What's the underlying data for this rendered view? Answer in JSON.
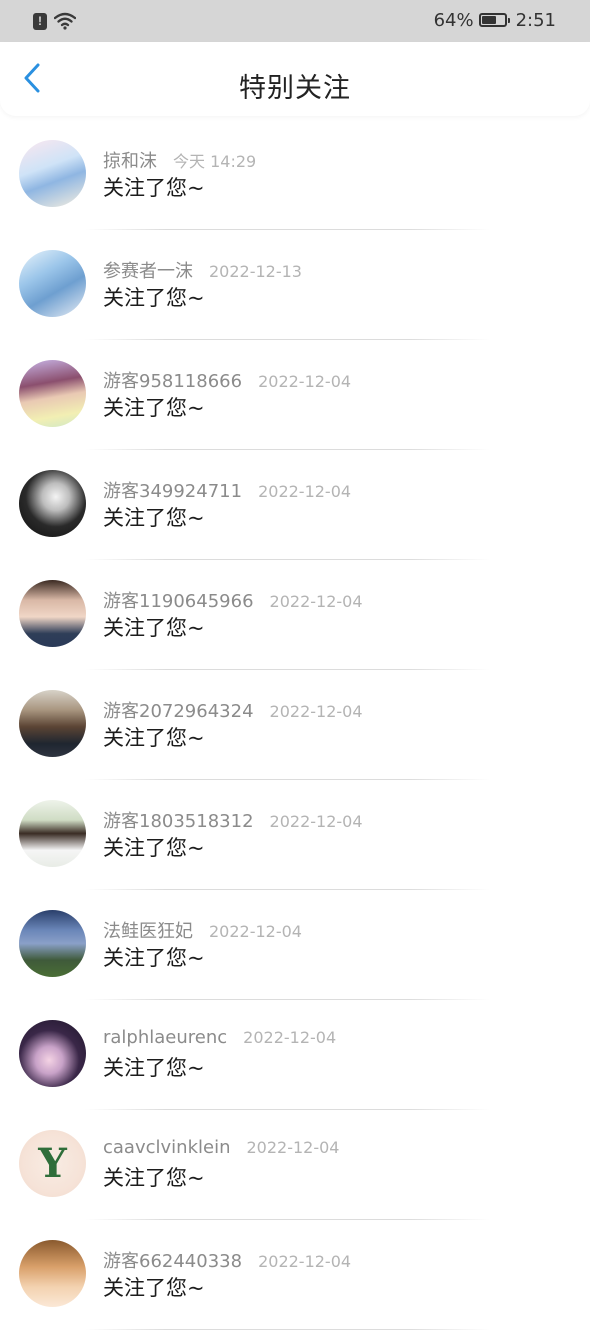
{
  "status_bar": {
    "battery_percent": "64%",
    "battery_level": 0.64,
    "time": "2:51",
    "icons": [
      "alert-icon",
      "wifi-icon",
      "battery-icon"
    ]
  },
  "header": {
    "title": "特别关注",
    "back_icon": "chevron-left-icon",
    "accent_color": "#2a90e0"
  },
  "list": {
    "items": [
      {
        "name": "掠和沫",
        "date": "今天 14:29",
        "action": "关注了您~",
        "avatar": {
          "bg": "linear-gradient(160deg,#fbe7ef 0%,#cfe3f7 40%,#8fb6e2 60%,#f6efe0 100%)",
          "glyph": ""
        }
      },
      {
        "name": "参赛者一沫",
        "date": "2022-12-13",
        "action": "关注了您~",
        "avatar": {
          "bg": "linear-gradient(150deg,#eaf4fb 0%,#9cc6ea 35%,#6e9fd0 60%,#e9eef5 100%)",
          "glyph": ""
        }
      },
      {
        "name": "游客958118666",
        "date": "2022-12-04",
        "action": "关注了您~",
        "avatar": {
          "bg": "linear-gradient(170deg,#c9b6e8 0%,#8b4f6e 35%,#e9c9b3 55%,#f2efb3 80%,#cfe8c6 100%)",
          "glyph": ""
        }
      },
      {
        "name": "游客349924711",
        "date": "2022-12-04",
        "action": "关注了您~",
        "avatar": {
          "bg": "radial-gradient(circle at 55% 40%,#f4f4f4 0%,#bdbdbd 25%,#2a2a2a 55%,#0e0e0e 100%)",
          "glyph": ""
        }
      },
      {
        "name": "游客1190645966",
        "date": "2022-12-04",
        "action": "关注了您~",
        "avatar": {
          "bg": "linear-gradient(180deg,#3b2a22 0%,#d9b8a6 30%,#f0d6c6 55%,#2f3e58 80%,#2a3a58 100%)",
          "glyph": ""
        }
      },
      {
        "name": "游客2072964324",
        "date": "2022-12-04",
        "action": "关注了您~",
        "avatar": {
          "bg": "linear-gradient(180deg,#d7d2c8 0%,#a8957f 30%,#5b4434 55%,#1f2630 80%,#2e3440 100%)",
          "glyph": ""
        }
      },
      {
        "name": "游客1803518312",
        "date": "2022-12-04",
        "action": "关注了您~",
        "avatar": {
          "bg": "linear-gradient(180deg,#eef3ea 0%,#cfdcc4 30%,#3a2c24 50%,#f5f5f5 75%,#e8ece6 100%)",
          "glyph": ""
        }
      },
      {
        "name": "法鲑医狂妃",
        "date": "2022-12-04",
        "action": "关注了您~",
        "avatar": {
          "bg": "linear-gradient(180deg,#2a3f6b 0%,#6a86b8 30%,#8aa0c8 50%,#3f5a3a 75%,#4a6e35 100%)",
          "glyph": ""
        }
      },
      {
        "name": "ralphlaeurenc",
        "date": "2022-12-04",
        "action": "关注了您~",
        "avatar": {
          "bg": "radial-gradient(circle at 45% 60%,#f4d3e4 0%,#c8a2c8 25%,#3a2748 55%,#1c1428 100%)",
          "glyph": ""
        }
      },
      {
        "name": "caavclvinklein",
        "date": "2022-12-04",
        "action": "关注了您~",
        "avatar": {
          "bg": "radial-gradient(circle at 50% 50%,#f8ece3 0%,#f6e3d8 60%,#f1d9cb 100%)",
          "glyph": "Y"
        }
      },
      {
        "name": "游客662440338",
        "date": "2022-12-04",
        "action": "关注了您~",
        "avatar": {
          "bg": "linear-gradient(180deg,#8a5a2e 0%,#d9a06a 40%,#f3d2b0 70%,#fbe8d6 100%)",
          "glyph": ""
        }
      }
    ]
  }
}
